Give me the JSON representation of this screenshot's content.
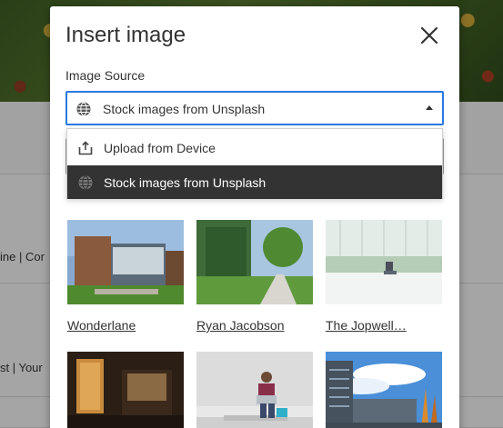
{
  "background": {
    "row1_text": "ine | Cor",
    "row2_text": "st | Your"
  },
  "modal": {
    "title": "Insert image",
    "close_icon": "close-icon"
  },
  "image_source": {
    "label": "Image Source",
    "selected_value": "Stock images from Unsplash",
    "options": [
      {
        "label": "Upload from Device",
        "icon": "upload-icon"
      },
      {
        "label": "Stock images from Unsplash",
        "icon": "globe-icon",
        "selected": true
      }
    ]
  },
  "results": [
    {
      "credit": "Wonderlane"
    },
    {
      "credit": "Ryan Jacobson"
    },
    {
      "credit": "The Jopwell…"
    },
    {
      "credit": ""
    },
    {
      "credit": ""
    },
    {
      "credit": ""
    }
  ],
  "colors": {
    "accent": "#2a7ae0",
    "selected_option_bg": "#333333"
  }
}
